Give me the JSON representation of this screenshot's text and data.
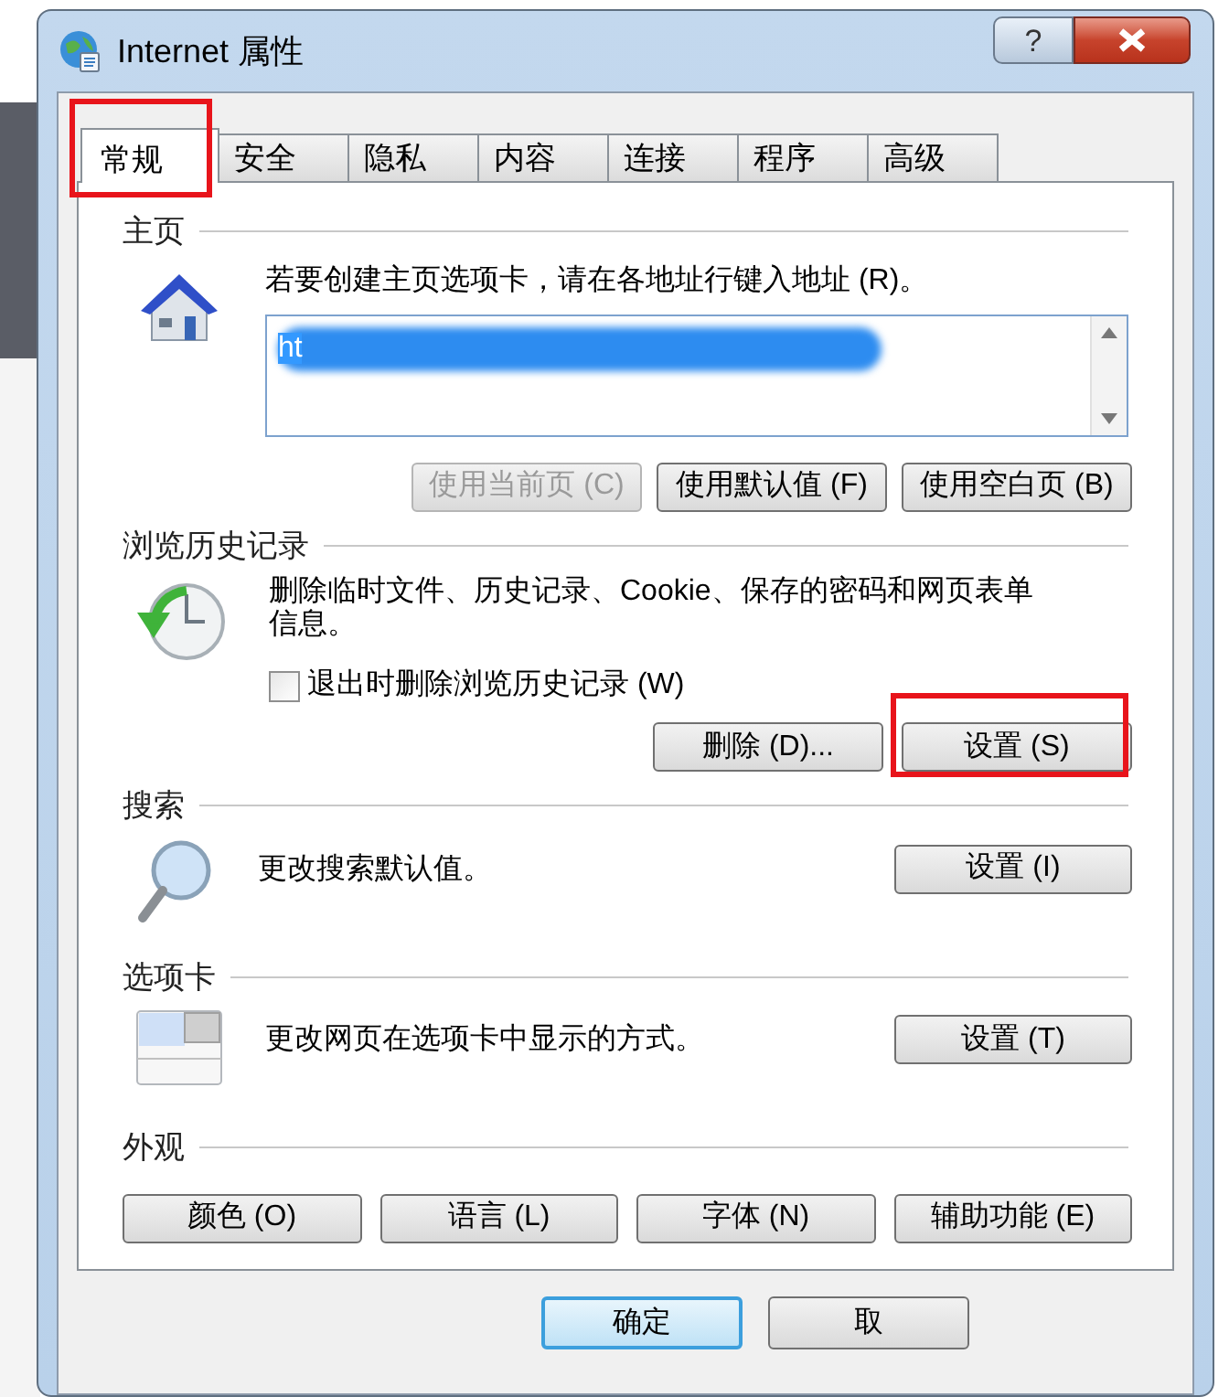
{
  "window": {
    "title": "Internet 属性",
    "help_button": "?"
  },
  "tabs": [
    {
      "label": "常规",
      "selected": true,
      "highlighted": true
    },
    {
      "label": "安全",
      "selected": false,
      "highlighted": false
    },
    {
      "label": "隐私",
      "selected": false,
      "highlighted": false
    },
    {
      "label": "内容",
      "selected": false,
      "highlighted": false
    },
    {
      "label": "连接",
      "selected": false,
      "highlighted": false
    },
    {
      "label": "程序",
      "selected": false,
      "highlighted": false
    },
    {
      "label": "高级",
      "selected": false,
      "highlighted": false
    }
  ],
  "sections": [
    {
      "kind": "homepage",
      "heading": "主页",
      "description": "若要创建主页选项卡，请在各地址行键入地址 (R)。",
      "address": {
        "value": "ht",
        "selected": true,
        "redacted": true
      },
      "buttons": [
        {
          "label": "使用当前页 (C)",
          "disabled": true
        },
        {
          "label": "使用默认值 (F)",
          "disabled": false
        },
        {
          "label": "使用空白页 (B)",
          "disabled": false
        }
      ]
    },
    {
      "kind": "history",
      "heading": "浏览历史记录",
      "description": "删除临时文件、历史记录、Cookie、保存的密码和网页表单信息。",
      "checkbox": {
        "label": "退出时删除浏览历史记录 (W)",
        "checked": false
      },
      "buttons": [
        {
          "label": "删除 (D)...",
          "highlighted": false
        },
        {
          "label": "设置 (S)",
          "highlighted": true
        }
      ]
    },
    {
      "kind": "search",
      "heading": "搜索",
      "description": "更改搜索默认值。",
      "buttons": [
        {
          "label": "设置 (I)"
        }
      ]
    },
    {
      "kind": "tabs",
      "heading": "选项卡",
      "description": "更改网页在选项卡中显示的方式。",
      "buttons": [
        {
          "label": "设置 (T)"
        }
      ]
    },
    {
      "kind": "appearance",
      "heading": "外观",
      "buttons": [
        {
          "label": "颜色 (O)"
        },
        {
          "label": "语言 (L)"
        },
        {
          "label": "字体 (N)"
        },
        {
          "label": "辅助功能 (E)"
        }
      ]
    }
  ],
  "footer_buttons": [
    {
      "label": "确定",
      "default": true
    },
    {
      "label": "取",
      "default": false
    }
  ]
}
